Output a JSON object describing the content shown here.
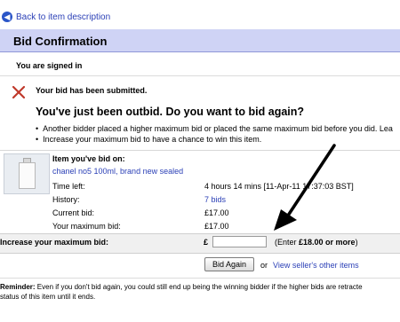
{
  "back_link": "Back to item description",
  "header": {
    "title": "Bid Confirmation"
  },
  "status": {
    "signed_in": "You are signed in"
  },
  "notice": {
    "submitted": "Your bid has been submitted.",
    "outbid_title": "You've just been outbid. Do you want to bid again?",
    "bullets": [
      "Another bidder placed a higher maximum bid or placed the same maximum bid before you did. Lea",
      "Increase your maximum bid to have a chance to win this item."
    ]
  },
  "item": {
    "heading": "Item you've bid on:",
    "title": "chanel no5 100ml, brand new sealed",
    "rows": [
      {
        "label": "Time left:",
        "value": "4 hours 14 mins [11-Apr-11 17:37:03 BST]"
      },
      {
        "label": "History:",
        "value": "7 bids"
      },
      {
        "label": "Current bid:",
        "value": "£17.00"
      },
      {
        "label": "Your maximum bid:",
        "value": "£17.00"
      }
    ]
  },
  "increase": {
    "label": "Increase your maximum bid:",
    "currency": "£",
    "input_value": "",
    "hint_prefix": "(Enter ",
    "hint_amount": "£18.00 or more",
    "hint_suffix": ")"
  },
  "actions": {
    "bid_again": "Bid Again",
    "or": "or",
    "seller_link": "View seller's other items"
  },
  "reminder": {
    "label": "Reminder:",
    "text_line1": " Even if you don't bid again, you could still end up being the winning bidder if the higher bids are retracte",
    "text_line2": "status of this item until it ends."
  },
  "colors": {
    "header_bg": "#cfd3f5",
    "link": "#2a3fb6",
    "error_x": "#c0392b"
  }
}
